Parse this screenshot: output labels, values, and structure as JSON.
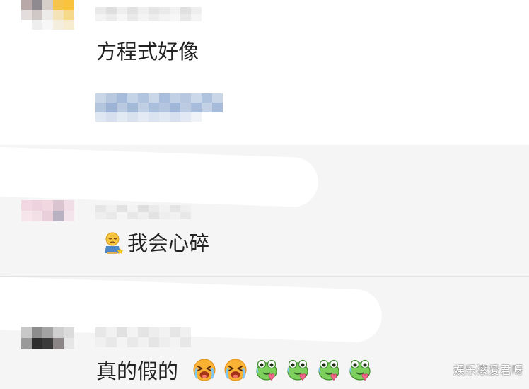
{
  "comments": [
    {
      "text": "方程式好像"
    },
    {
      "text": "我会心碎",
      "emoji": "sitting-sad-emoji"
    },
    {
      "text": "真的假的",
      "emoji": [
        "crying-face-emoji",
        "crying-face-emoji",
        "frog-heart-emoji",
        "frog-heart-emoji",
        "frog-heart-emoji",
        "frog-heart-emoji"
      ]
    }
  ],
  "watermark": "娱乐滚爱君呀",
  "colors": {
    "background_top": "#ffffff",
    "background_bottom": "#f5f5f5",
    "text": "#222222",
    "link_blur": "#a9bfdc"
  }
}
